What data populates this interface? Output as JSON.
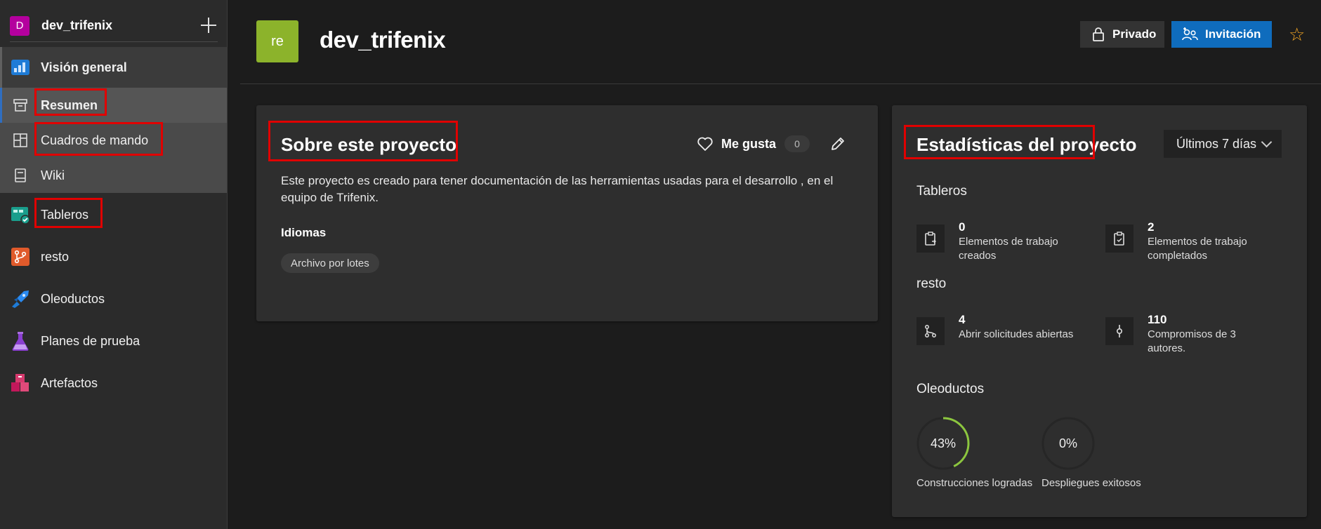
{
  "org": {
    "initial": "D",
    "name": "dev_trifenix"
  },
  "nav": {
    "overview": "Visión general",
    "summary": "Resumen",
    "dashboards": "Cuadros de mando",
    "wiki": "Wiki",
    "boards": "Tableros",
    "repos": "resto",
    "pipelines": "Oleoductos",
    "test_plans": "Planes de prueba",
    "artifacts": "Artefactos"
  },
  "header": {
    "avatar": "re",
    "title": "dev_trifenix",
    "private_label": "Privado",
    "invite_label": "Invitación",
    "star": "☆"
  },
  "about": {
    "title": "Sobre este proyecto",
    "like_label": "Me gusta",
    "like_count": "0",
    "description": "Este proyecto es creado para tener documentación de las herramientas usadas para el desarrollo , en el equipo de Trifenix.",
    "languages_title": "Idiomas",
    "language_tag": "Archivo por lotes"
  },
  "stats": {
    "title": "Estadísticas del proyecto",
    "range": "Últimos 7 días",
    "boards_title": "Tableros",
    "created_num": "0",
    "created_text": "Elementos de trabajo creados",
    "completed_num": "2",
    "completed_text": "Elementos de trabajo completados",
    "repos_title": "resto",
    "pr_num": "4",
    "pr_text": "Abrir solicitudes abiertas",
    "commits_num": "110",
    "commits_text": "Compromisos de 3 autores.",
    "pipelines_title": "Oleoductos",
    "builds_pct": "43%",
    "builds_value": 0.43,
    "builds_label": "Construcciones logradas",
    "deploys_pct": "0%",
    "deploys_value": 0,
    "deploys_label": "Despliegues exitosos"
  },
  "colors": {
    "accent": "#0f6cbd",
    "org_avatar": "#b4009e",
    "project_avatar": "#8cb32b",
    "success_ring": "#8cc63f",
    "highlight_box": "#e00000",
    "star": "#f5a623"
  }
}
